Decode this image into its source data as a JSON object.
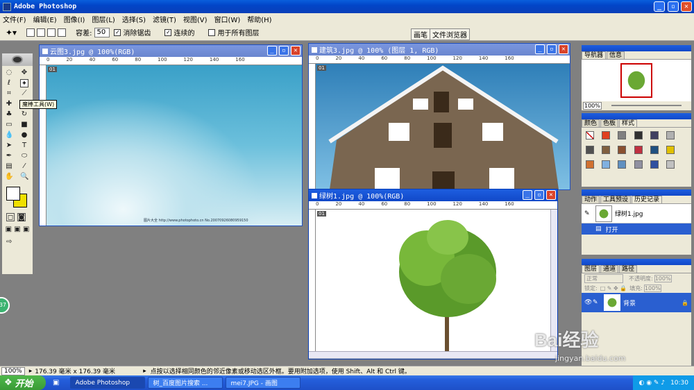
{
  "app": {
    "title": "Adobe Photoshop"
  },
  "menu": [
    "文件(F)",
    "编辑(E)",
    "图像(I)",
    "图层(L)",
    "选择(S)",
    "滤镜(T)",
    "视图(V)",
    "窗口(W)",
    "帮助(H)"
  ],
  "options": {
    "tolerance_label": "容差:",
    "tolerance_value": "50",
    "antialias": "消除锯齿",
    "contiguous": "连续的",
    "all_layers": "用于所有图层",
    "brush_tab": "画笔",
    "browser_tab": "文件浏览器"
  },
  "tooltip": "魔棒工具(W)",
  "docs": {
    "cloud": {
      "title": "云图3.jpg @ 100%(RGB)",
      "watermark": "图片大全 http://www.photophoto.cn No.20070926080959150"
    },
    "building": {
      "title": "建筑3.jpg @ 100% (图层 1, RGB)"
    },
    "tree": {
      "title": "绿树1.jpg @ 100%(RGB)"
    }
  },
  "ruler": {
    "marks": [
      "0",
      "20",
      "40",
      "60",
      "80",
      "100",
      "120",
      "140",
      "160"
    ],
    "corner": "01"
  },
  "navigator": {
    "tabs": [
      "导航器",
      "信息"
    ],
    "zoom": "100%"
  },
  "swatches": {
    "tabs": [
      "颜色",
      "色板",
      "样式"
    ]
  },
  "history": {
    "tabs": [
      "动作",
      "工具预设",
      "历史记录"
    ],
    "snapshot": "绿树1.jpg",
    "step": "打开"
  },
  "layers": {
    "tabs": [
      "图层",
      "通道",
      "路径"
    ],
    "mode": "正常",
    "opacity_label": "不透明度:",
    "opacity": "100%",
    "lock_label": "锁定:",
    "fill_label": "填充:",
    "fill": "100%",
    "layer_name": "背景"
  },
  "status": {
    "zoom": "100%",
    "size": "176.39 毫米 x 176.39 毫米",
    "hint": "点按以选择相同颜色的邻近像素或移动选区外框。要用附加选项，使用 Shift、Alt 和 Ctrl 键。"
  },
  "taskbar": {
    "start": "开始",
    "items": [
      "Adobe Photoshop",
      "树_百度图片搜索 ...",
      "mei7.JPG - 画图"
    ],
    "time": "10:30"
  },
  "watermark": {
    "brand": "Bai经验",
    "url": "jingyan.baidu.com"
  },
  "badge": "37"
}
